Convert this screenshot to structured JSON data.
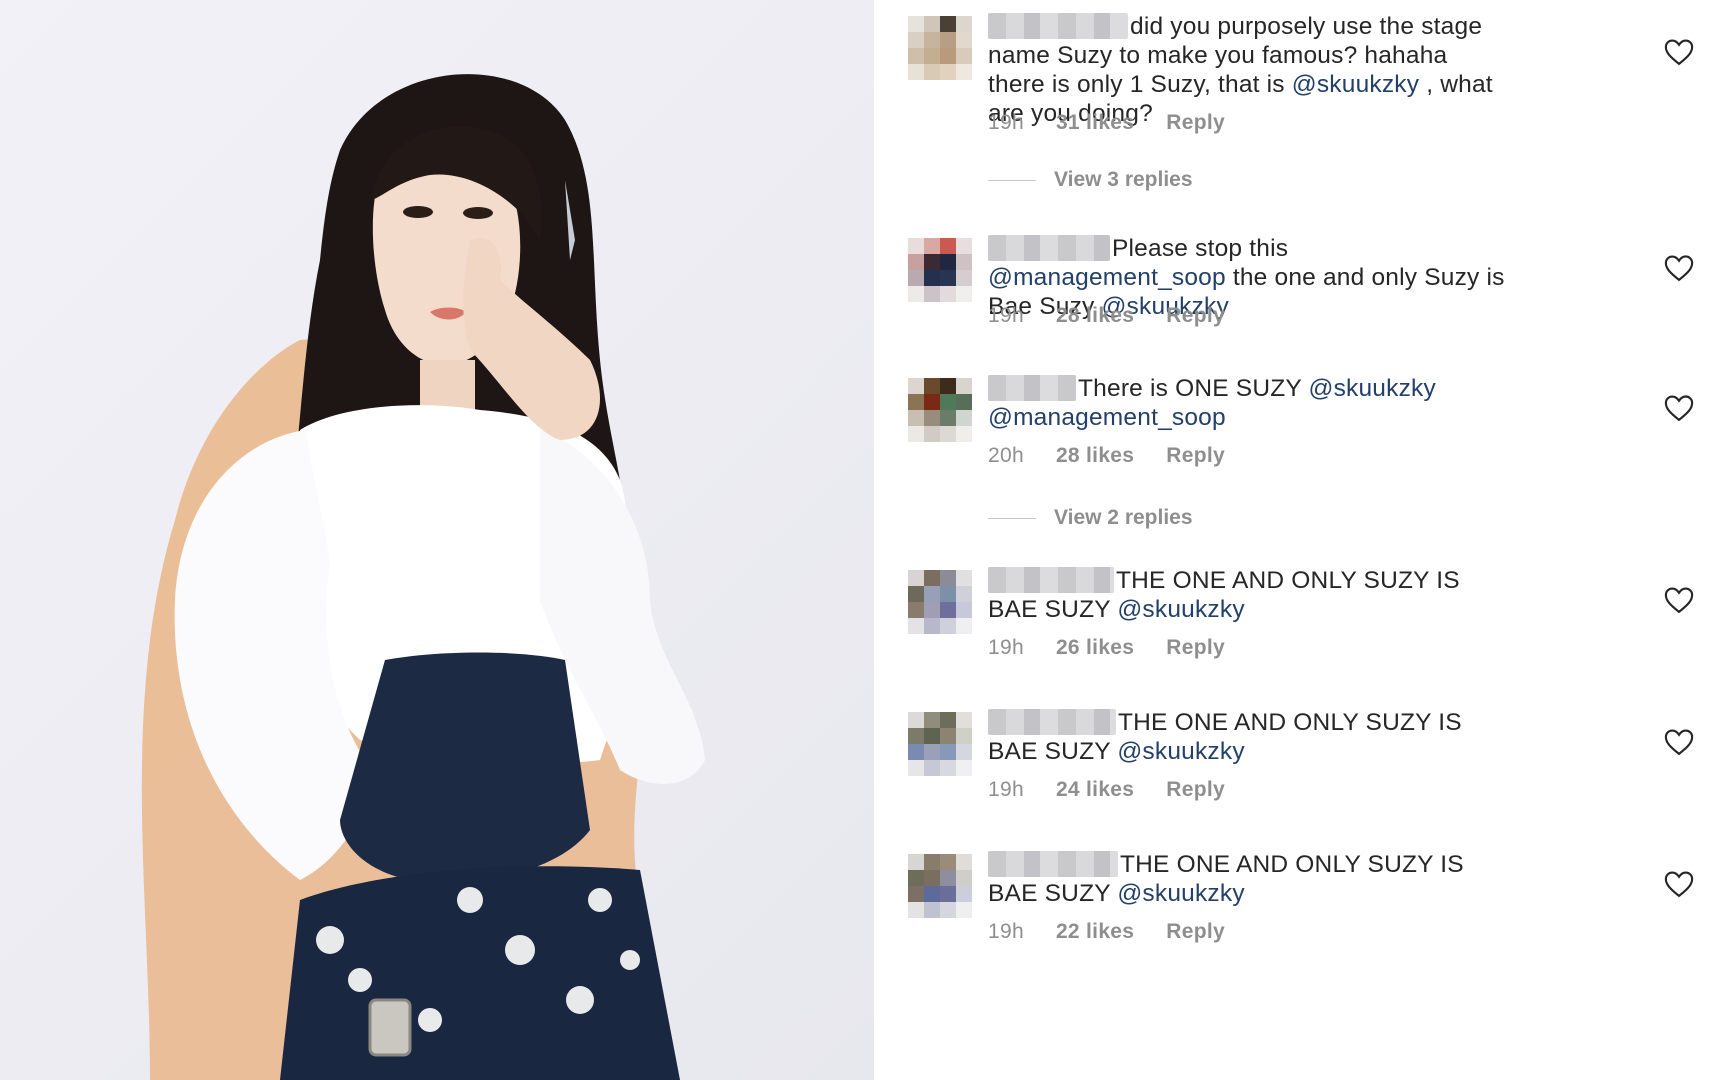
{
  "photo": {
    "subject": "portrait"
  },
  "comments": [
    {
      "text_parts": [
        {
          "type": "text",
          "value": "did you purposely use the stage name Suzy to make you famous? hahaha there is only 1 Suzy, that is "
        },
        {
          "type": "mention",
          "value": "@skuukzky"
        },
        {
          "type": "text",
          "value": " , what are you doing?"
        }
      ],
      "time": "19h",
      "likes": "31 likes",
      "reply": "Reply"
    },
    {
      "text_parts": [
        {
          "type": "text",
          "value": "Please stop this "
        },
        {
          "type": "mention",
          "value": "@management_soop"
        },
        {
          "type": "text",
          "value": " the one and only Suzy is Bae Suzy "
        },
        {
          "type": "mention",
          "value": "@skuukzky"
        }
      ],
      "time": "19h",
      "likes": "28 likes",
      "reply": "Reply"
    },
    {
      "text_parts": [
        {
          "type": "text",
          "value": "There is ONE SUZY "
        },
        {
          "type": "mention",
          "value": "@skuukzky"
        },
        {
          "type": "text",
          "value": " "
        },
        {
          "type": "mention",
          "value": "@management_soop"
        }
      ],
      "time": "20h",
      "likes": "28 likes",
      "reply": "Reply"
    },
    {
      "text_parts": [
        {
          "type": "text",
          "value": "THE ONE AND ONLY SUZY IS BAE SUZY "
        },
        {
          "type": "mention",
          "value": "@skuukzky"
        }
      ],
      "time": "19h",
      "likes": "26 likes",
      "reply": "Reply"
    },
    {
      "text_parts": [
        {
          "type": "text",
          "value": "THE ONE AND ONLY SUZY IS BAE SUZY "
        },
        {
          "type": "mention",
          "value": "@skuukzky"
        }
      ],
      "time": "19h",
      "likes": "24 likes",
      "reply": "Reply"
    },
    {
      "text_parts": [
        {
          "type": "text",
          "value": "THE ONE AND ONLY SUZY IS BAE SUZY "
        },
        {
          "type": "mention",
          "value": "@skuukzky"
        }
      ],
      "time": "19h",
      "likes": "22 likes",
      "reply": "Reply"
    }
  ],
  "view_replies": [
    "View 3 replies",
    "View 2 replies"
  ],
  "icons": {
    "like": "heart-icon"
  },
  "colors": {
    "mention": "#23406b",
    "text": "#262626",
    "meta": "#8e8e8e"
  },
  "avatars": [
    [
      "#e6e2dc",
      "#cfc5b8",
      "#4a4136",
      "#dcd6cf",
      "#d9cfc2",
      "#c8b39c",
      "#b89f83",
      "#e2d9ce",
      "#cdbfa9",
      "#c4ae92",
      "#b79b7c",
      "#d8cbb9",
      "#e7e1d8",
      "#d8cab5",
      "#e0d2bf",
      "#eee8e0"
    ],
    [
      "#e8dcdc",
      "#d9a8a0",
      "#c85a52",
      "#e9dede",
      "#c9a0a0",
      "#3b2a34",
      "#1f2840",
      "#cfc2c4",
      "#b8aab0",
      "#23304e",
      "#273452",
      "#d6cdd0",
      "#efeaea",
      "#ccc3c8",
      "#e2dadc",
      "#f1eeee"
    ],
    [
      "#ddd6d0",
      "#6a4a2c",
      "#3e2b1b",
      "#d9d4cd",
      "#8b7355",
      "#7a2a14",
      "#4f7a5a",
      "#596e58",
      "#c8bfb2",
      "#9a8c7c",
      "#6b7c6a",
      "#cfd6cf",
      "#ece8e3",
      "#d1cbc3",
      "#dcd8d2",
      "#f0eeea"
    ],
    [
      "#d8d4d4",
      "#7b6e60",
      "#8c8c98",
      "#e2dfe0",
      "#6c6a58",
      "#98a0b8",
      "#7c90a8",
      "#d0d0d8",
      "#8a7c6c",
      "#a09eb4",
      "#6e6f9a",
      "#c7c9da",
      "#e4e2e4",
      "#b8b8cc",
      "#d0d0dc",
      "#efeff2"
    ],
    [
      "#dcdad6",
      "#8f8d7c",
      "#6e6d5c",
      "#e1dfda",
      "#7c7a68",
      "#5e6450",
      "#8c8470",
      "#cfd0c8",
      "#7a8ab0",
      "#9aa0b8",
      "#8898b8",
      "#d4d6e0",
      "#e6e6e8",
      "#c6c8d6",
      "#d8d8e0",
      "#f0f0f2"
    ],
    [
      "#d8d6d2",
      "#8a7c6a",
      "#9a8c78",
      "#e0ddd8",
      "#6e6c5a",
      "#7a6e5e",
      "#8e8e9e",
      "#d0ceca",
      "#7c7066",
      "#5e6a9a",
      "#6c6e9a",
      "#cccedc",
      "#e4e2e2",
      "#c0c2d2",
      "#d6d6de",
      "#efeff0"
    ]
  ]
}
